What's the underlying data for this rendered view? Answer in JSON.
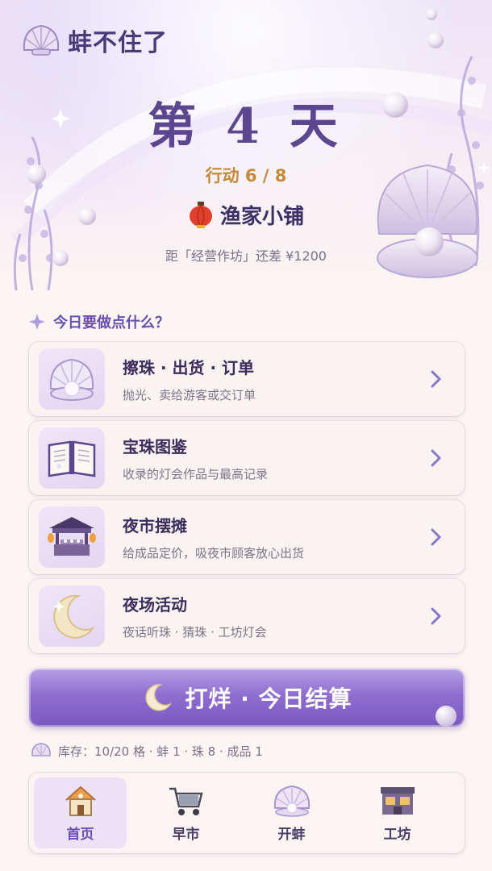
{
  "header": {
    "app_title": "蚌不住了",
    "day_title": "第 4 天",
    "actions_text": "行动 6 / 8",
    "shop_name": "渔家小铺",
    "goal_text": "距「经营作坊」还差 ¥1200"
  },
  "section": {
    "title": "今日要做点什么？"
  },
  "menu": [
    {
      "title": "擦珠 · 出货 · 订单",
      "subtitle": "抛光、卖给游客或交订单",
      "icon": "pearl-shell-icon"
    },
    {
      "title": "宝珠图鉴",
      "subtitle": "收录的灯会作品与最高记录",
      "icon": "book-icon"
    },
    {
      "title": "夜市摆摊",
      "subtitle": "给成品定价，吸夜市顾客放心出货",
      "icon": "market-stall-icon"
    },
    {
      "title": "夜场活动",
      "subtitle": "夜话听珠 · 猜珠 · 工坊灯会",
      "icon": "moon-icon"
    }
  ],
  "cta": {
    "label": "打烊 · 今日结算"
  },
  "inventory": {
    "text": "库存：10/20 格 · 蚌 1 · 珠 8 · 成品 1"
  },
  "tabs": [
    {
      "label": "首页",
      "icon": "house-icon",
      "active": true
    },
    {
      "label": "早市",
      "icon": "cart-icon",
      "active": false
    },
    {
      "label": "开蚌",
      "icon": "shell-icon",
      "active": false
    },
    {
      "label": "工坊",
      "icon": "workshop-icon",
      "active": false
    }
  ],
  "colors": {
    "accent": "#7a58c0",
    "title": "#5b4690",
    "actions_gold": "#c38a3a",
    "background": "#fbf5f3"
  }
}
